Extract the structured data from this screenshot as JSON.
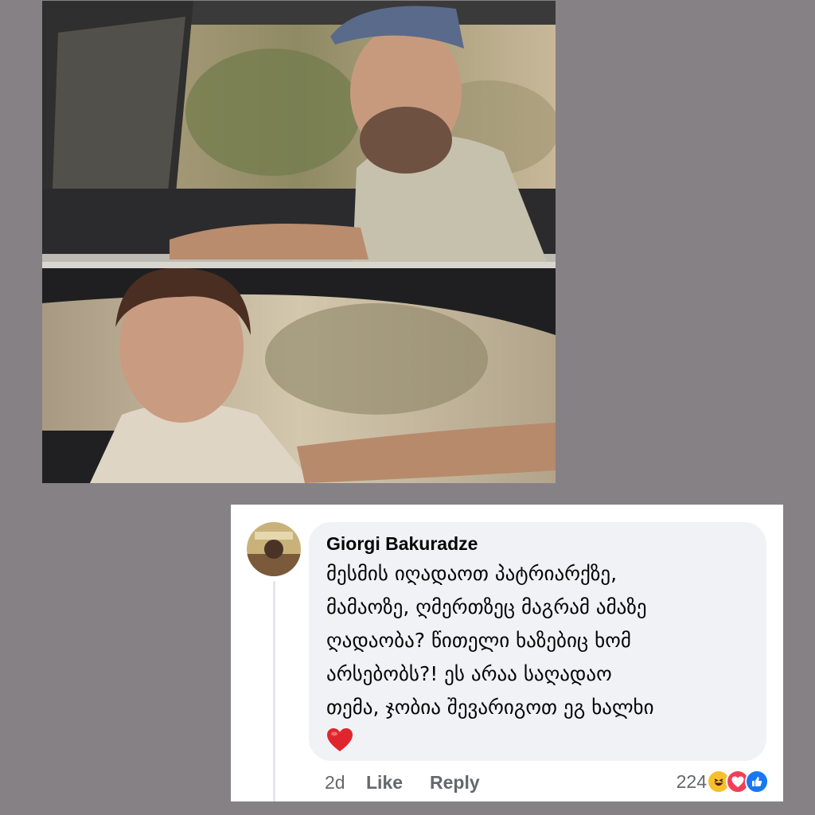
{
  "comment": {
    "author": "Giorgi Bakuradze",
    "text": "მესმის იღადაოთ პატრიარქზე,\nმამაოზე, ღმერთზეც მაგრამ ამაზე\nღადაობა? წითელი ხაზებიც ხომ\nარსებობს?! ეს არაა საღადაო\nთემა, ჯობია შევარიგოთ ეგ ხალხი",
    "emoji": "heart",
    "time": "2d",
    "like_label": "Like",
    "reply_label": "Reply",
    "reaction_count": "224",
    "reaction_icons": [
      "haha-icon",
      "love-icon",
      "like-icon"
    ]
  },
  "colors": {
    "page_background": "#868184",
    "bubble": "#f0f2f5",
    "heart": "#e0262d",
    "like_blue": "#1877f2",
    "haha_yellow": "#f7c02b",
    "love_red": "#f33e58"
  }
}
